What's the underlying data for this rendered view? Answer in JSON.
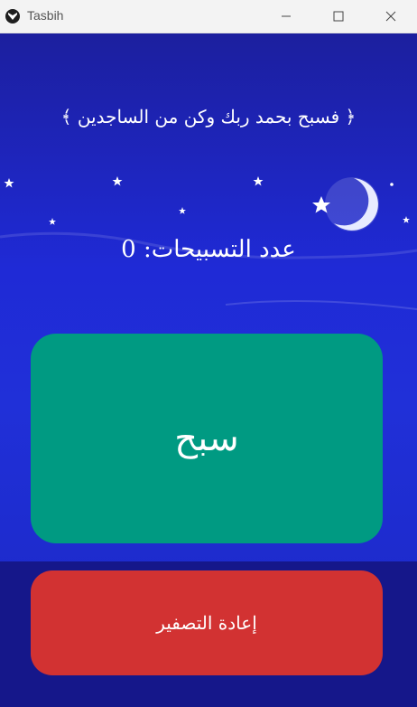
{
  "window": {
    "title": "Tasbih"
  },
  "verse": "﴿ فسبح بحمد ربك وكن من الساجدين ﴾",
  "counter": {
    "label": "عدد التسبيحات: 0"
  },
  "buttons": {
    "tasbih": "سبح",
    "reset": "إعادة التصفير"
  },
  "colors": {
    "tasbih_button": "#009a82",
    "reset_button": "#d23232",
    "background": "#1f2ad6"
  }
}
